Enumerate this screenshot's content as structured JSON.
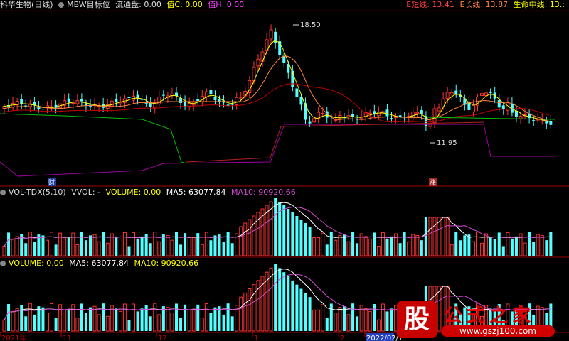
{
  "header": {
    "stock": "科华生物(日线)",
    "indicator": "MBW目标位",
    "float_label": "流通盘: 0.00",
    "valc_label": "值C: 0.00",
    "valh_label": "值H: 0.00",
    "e_short": "E短线: 13.41",
    "e_long": "E长线: 13.87",
    "life_line": "生命中线: 13.:"
  },
  "colors": {
    "up": "#ff3232",
    "down": "#54ffff",
    "ma5": "#ffffff",
    "ma10": "#d24bd2",
    "yellow": "#ffff00",
    "orange": "#ff8040",
    "green": "#00c000",
    "purple": "#a000a0",
    "red": "#c00000"
  },
  "price_labels": {
    "high": "18.50",
    "low": "11.95"
  },
  "markers": {
    "cai": "财",
    "zhang": "涨"
  },
  "vol_panel": {
    "name": "VOL-TDX(5,10)",
    "vvol": "VVOL: -",
    "volume": "VOLUME: 0.00",
    "ma5": "MA5: 63077.84",
    "ma10": "MA10: 90920.66"
  },
  "vol2_panel": {
    "volume": "VOLUME: 0.00",
    "ma5": "MA5: 63077.84",
    "ma10": "MA10: 90920.66"
  },
  "x_axis": [
    "2021年",
    "11",
    "12",
    "1",
    "2",
    "2022/02/1"
  ],
  "watermark": {
    "logo": "股",
    "title": "公式之家",
    "url": "www.gszj100.com"
  }
}
